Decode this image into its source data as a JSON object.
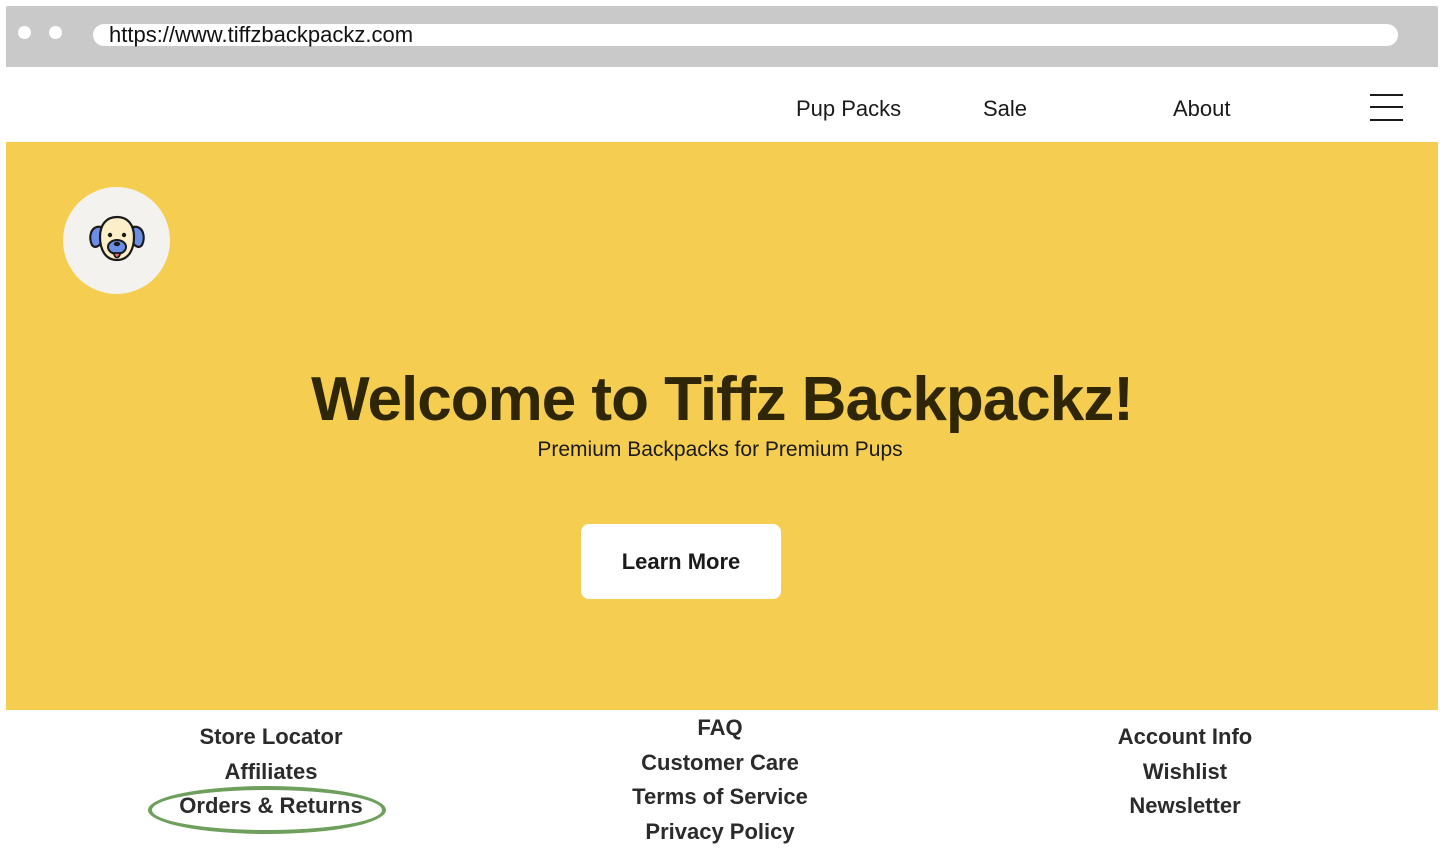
{
  "browser": {
    "url": "https://www.tiffzbackpackz.com"
  },
  "nav": {
    "links": [
      "Pup Packs",
      "Sale",
      "About"
    ],
    "menu_icon": "hamburger-menu-icon"
  },
  "hero": {
    "logo_icon": "dog-face-icon",
    "title": "Welcome to Tiffz Backpackz!",
    "subtitle": "Premium Backpacks for Premium Pups",
    "cta_label": "Learn More",
    "background_color": "#f5cd50"
  },
  "footer": {
    "col1": [
      "Store Locator",
      "Affiliates",
      "Orders & Returns"
    ],
    "col2": [
      "FAQ",
      "Customer Care",
      "Terms of Service",
      "Privacy Policy"
    ],
    "col3": [
      "Account Info",
      "Wishlist",
      "Newsletter"
    ],
    "highlighted_item": "Orders & Returns",
    "highlight_color": "#6f9f5c"
  }
}
